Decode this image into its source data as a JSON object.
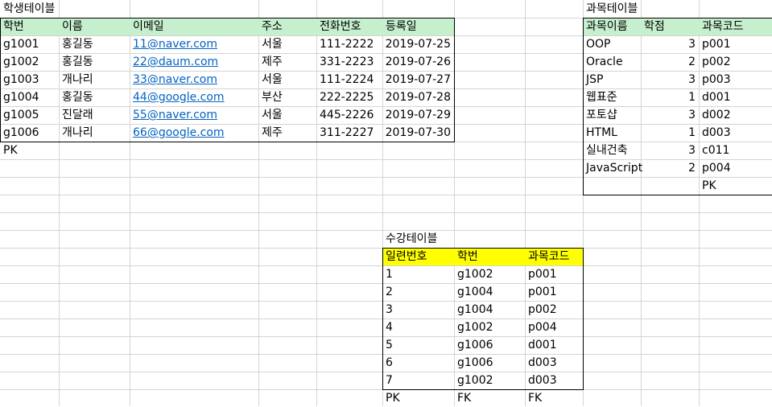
{
  "student_table": {
    "title": "학생테이블",
    "headers": [
      "학번",
      "이름",
      "이메일",
      "주소",
      "전화번호",
      "등록일"
    ],
    "rows": [
      [
        "g1001",
        "홍길동",
        "11@naver.com",
        "서울",
        "111-2222",
        "2019-07-25"
      ],
      [
        "g1002",
        "홍길동",
        "22@daum.com",
        "제주",
        "331-2223",
        "2019-07-26"
      ],
      [
        "g1003",
        "개나리",
        "33@naver.com",
        "서울",
        "111-2224",
        "2019-07-27"
      ],
      [
        "g1004",
        "홍길동",
        "44@google.com",
        "부산",
        "222-2225",
        "2019-07-28"
      ],
      [
        "g1005",
        "진달래",
        "55@naver.com",
        "서울",
        "445-2226",
        "2019-07-29"
      ],
      [
        "g1006",
        "개나리",
        "66@google.com",
        "제주",
        "311-2227",
        "2019-07-30"
      ]
    ],
    "key_note": "PK"
  },
  "course_table": {
    "title": "과목테이블",
    "headers": [
      "과목이름",
      "학점",
      "과목코드"
    ],
    "rows": [
      [
        "OOP",
        "3",
        "p001"
      ],
      [
        "Oracle",
        "2",
        "p002"
      ],
      [
        "JSP",
        "3",
        "p003"
      ],
      [
        "웹표준",
        "1",
        "d001"
      ],
      [
        "포토샵",
        "3",
        "d002"
      ],
      [
        "HTML",
        "1",
        "d003"
      ],
      [
        "실내건축",
        "3",
        "c011"
      ],
      [
        "JavaScript",
        "2",
        "p004"
      ]
    ],
    "key_note": "PK"
  },
  "enroll_table": {
    "title": "수강테이블",
    "headers": [
      "일련번호",
      "학번",
      "과목코드"
    ],
    "rows": [
      [
        "1",
        "g1002",
        "p001"
      ],
      [
        "2",
        "g1004",
        "p001"
      ],
      [
        "3",
        "g1004",
        "p002"
      ],
      [
        "4",
        "g1002",
        "p004"
      ],
      [
        "5",
        "g1006",
        "d001"
      ],
      [
        "6",
        "g1006",
        "d003"
      ],
      [
        "7",
        "g1002",
        "d003"
      ]
    ],
    "key_notes": [
      "PK",
      "FK",
      "FK"
    ]
  },
  "colors": {
    "header_green": "#c6efce",
    "header_yellow": "#ffff00",
    "link_blue": "#0563c1",
    "gridline": "#d4d4d4"
  }
}
